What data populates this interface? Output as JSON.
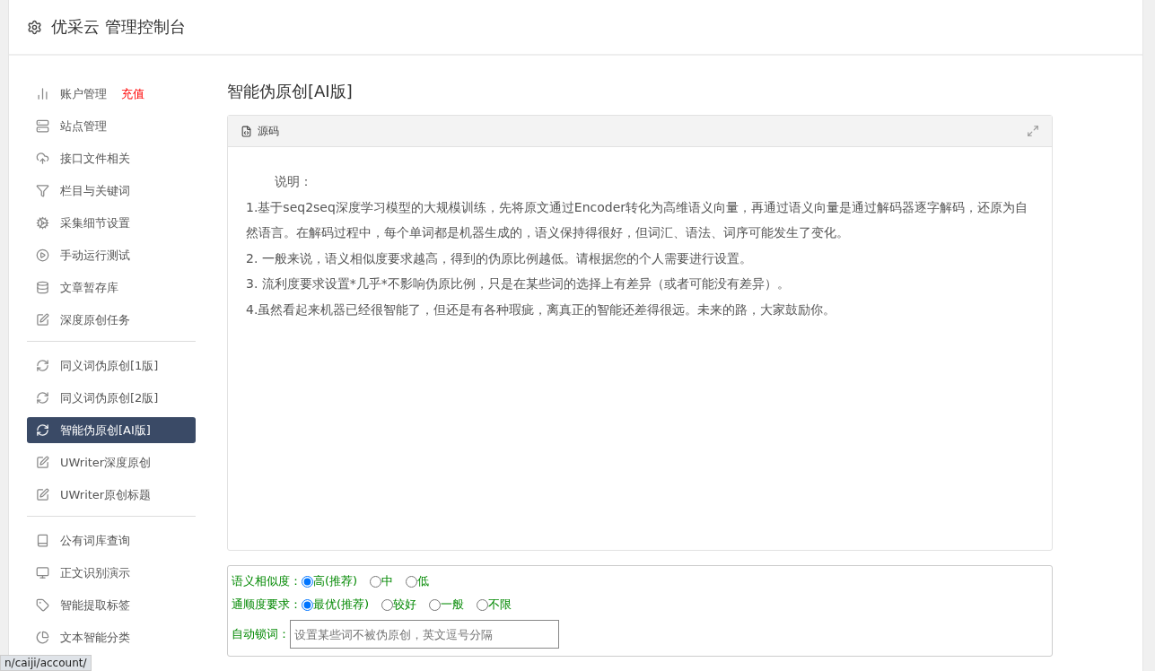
{
  "header": {
    "title": "优采云 管理控制台"
  },
  "sidebar": {
    "groups": [
      {
        "items": [
          {
            "label": "账户管理",
            "badge": "充值",
            "selected": false
          },
          {
            "label": "站点管理",
            "selected": false
          },
          {
            "label": "接口文件相关",
            "selected": false
          },
          {
            "label": "栏目与关键词",
            "selected": false
          },
          {
            "label": "采集细节设置",
            "selected": false
          },
          {
            "label": "手动运行测试",
            "selected": false
          },
          {
            "label": "文章暂存库",
            "selected": false
          },
          {
            "label": "深度原创任务",
            "selected": false
          }
        ]
      },
      {
        "items": [
          {
            "label": "同义词伪原创[1版]",
            "selected": false
          },
          {
            "label": "同义词伪原创[2版]",
            "selected": false
          },
          {
            "label": "智能伪原创[AI版]",
            "selected": true
          },
          {
            "label": "UWriter深度原创",
            "selected": false
          },
          {
            "label": "UWriter原创标题",
            "selected": false
          }
        ]
      },
      {
        "items": [
          {
            "label": "公有词库查询",
            "selected": false
          },
          {
            "label": "正文识别演示",
            "selected": false
          },
          {
            "label": "智能提取标签",
            "selected": false
          },
          {
            "label": "文本智能分类",
            "selected": false
          }
        ]
      }
    ]
  },
  "page": {
    "title": "智能伪原创[AI版]",
    "editor": {
      "tab": "源码",
      "lines": [
        "说明：",
        "1.基于seq2seq深度学习模型的大规模训练，先将原文通过Encoder转化为高维语义向量，再通过语义向量是通过解码器逐字解码，还原为自然语言。在解码过程中，每个单词都是机器生成的，语义保持得很好，但词汇、语法、词序可能发生了变化。",
        "2. 一般来说，语义相似度要求越高，得到的伪原比例越低。请根据您的个人需要进行设置。",
        "3. 流利度要求设置*几乎*不影响伪原比例，只是在某些词的选择上有差异（或者可能没有差异）。",
        "4.虽然看起来机器已经很智能了，但还是有各种瑕疵，离真正的智能还差得很远。未来的路，大家鼓励你。"
      ]
    },
    "options": [
      {
        "kind": "radio",
        "label": "语义相似度：",
        "choices": [
          {
            "label": "高(推荐)",
            "selected": true
          },
          {
            "label": "中",
            "selected": false
          },
          {
            "label": "低",
            "selected": false
          }
        ]
      },
      {
        "kind": "radio",
        "label": "通顺度要求：",
        "choices": [
          {
            "label": "最优(推荐)",
            "selected": true
          },
          {
            "label": "较好",
            "selected": false
          },
          {
            "label": "一般",
            "selected": false
          },
          {
            "label": "不限",
            "selected": false
          }
        ]
      },
      {
        "kind": "input",
        "label": "自动锁词：",
        "placeholder": "设置某些词不被伪原创，英文逗号分隔"
      }
    ]
  },
  "status_url": "n/caiji/account/"
}
